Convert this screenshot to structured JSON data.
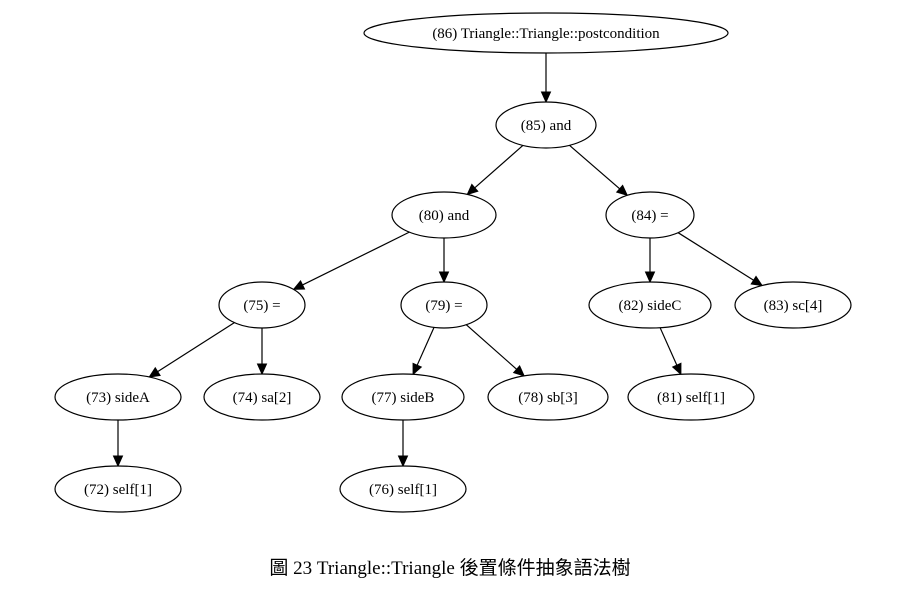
{
  "diagram": {
    "nodes": [
      {
        "id": "n86",
        "label": "(86) Triangle::Triangle::postcondition"
      },
      {
        "id": "n85",
        "label": "(85) and"
      },
      {
        "id": "n80",
        "label": "(80) and"
      },
      {
        "id": "n84",
        "label": "(84) ="
      },
      {
        "id": "n75",
        "label": "(75) ="
      },
      {
        "id": "n79",
        "label": "(79) ="
      },
      {
        "id": "n82",
        "label": "(82) sideC"
      },
      {
        "id": "n83",
        "label": "(83) sc[4]"
      },
      {
        "id": "n73",
        "label": "(73) sideA"
      },
      {
        "id": "n74",
        "label": "(74) sa[2]"
      },
      {
        "id": "n77",
        "label": "(77) sideB"
      },
      {
        "id": "n78",
        "label": "(78) sb[3]"
      },
      {
        "id": "n81",
        "label": "(81) self[1]"
      },
      {
        "id": "n72",
        "label": "(72) self[1]"
      },
      {
        "id": "n76",
        "label": "(76) self[1]"
      }
    ],
    "edges": [
      {
        "from": "n86",
        "to": "n85"
      },
      {
        "from": "n85",
        "to": "n80"
      },
      {
        "from": "n85",
        "to": "n84"
      },
      {
        "from": "n80",
        "to": "n75"
      },
      {
        "from": "n80",
        "to": "n79"
      },
      {
        "from": "n84",
        "to": "n82"
      },
      {
        "from": "n84",
        "to": "n83"
      },
      {
        "from": "n75",
        "to": "n73"
      },
      {
        "from": "n75",
        "to": "n74"
      },
      {
        "from": "n79",
        "to": "n77"
      },
      {
        "from": "n79",
        "to": "n78"
      },
      {
        "from": "n82",
        "to": "n81"
      },
      {
        "from": "n73",
        "to": "n72"
      },
      {
        "from": "n77",
        "to": "n76"
      }
    ]
  },
  "caption": {
    "text": "圖  23 Triangle::Triangle  後置條件抽象語法樹"
  }
}
